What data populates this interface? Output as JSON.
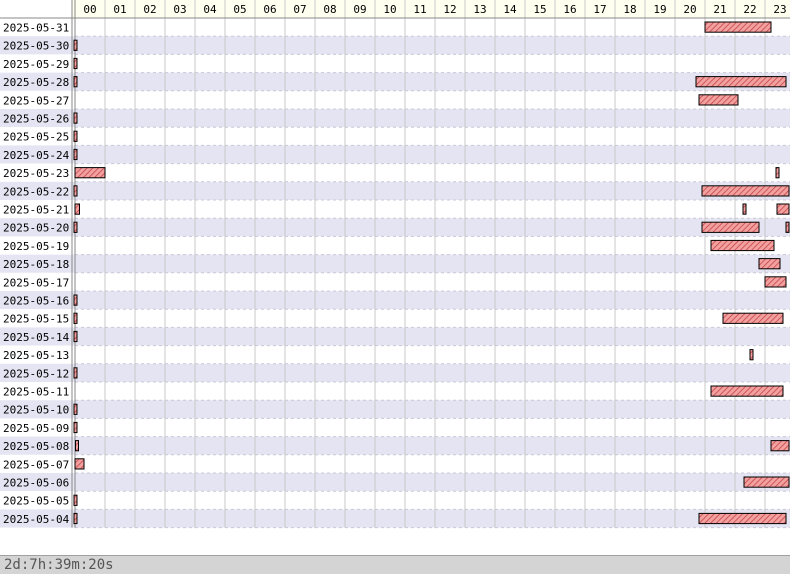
{
  "chart_data": {
    "type": "bar",
    "hours": [
      "00",
      "01",
      "02",
      "03",
      "04",
      "05",
      "06",
      "07",
      "08",
      "09",
      "10",
      "11",
      "12",
      "13",
      "14",
      "15",
      "16",
      "17",
      "18",
      "19",
      "20",
      "21",
      "22",
      "23"
    ],
    "rows": [
      {
        "date": "2025-05-31",
        "intervals": [
          [
            21.0,
            23.2
          ]
        ]
      },
      {
        "date": "2025-05-30",
        "intervals": [
          [
            0.0,
            0.04
          ]
        ]
      },
      {
        "date": "2025-05-29",
        "intervals": [
          [
            0.0,
            0.04
          ]
        ]
      },
      {
        "date": "2025-05-28",
        "intervals": [
          [
            0.0,
            0.04
          ],
          [
            20.7,
            23.7
          ]
        ]
      },
      {
        "date": "2025-05-27",
        "intervals": [
          [
            20.8,
            22.1
          ]
        ]
      },
      {
        "date": "2025-05-26",
        "intervals": [
          [
            0.0,
            0.04
          ]
        ]
      },
      {
        "date": "2025-05-25",
        "intervals": [
          [
            0.0,
            0.04
          ]
        ]
      },
      {
        "date": "2025-05-24",
        "intervals": [
          [
            0.0,
            0.04
          ]
        ]
      },
      {
        "date": "2025-05-23",
        "intervals": [
          [
            0.0,
            1.0
          ],
          [
            23.4,
            23.45
          ]
        ]
      },
      {
        "date": "2025-05-22",
        "intervals": [
          [
            0.0,
            0.04
          ],
          [
            20.9,
            23.8
          ]
        ]
      },
      {
        "date": "2025-05-21",
        "intervals": [
          [
            0.0,
            0.15
          ],
          [
            22.3,
            22.4
          ],
          [
            23.4,
            23.8
          ]
        ]
      },
      {
        "date": "2025-05-20",
        "intervals": [
          [
            0.0,
            0.04
          ],
          [
            20.9,
            22.8
          ],
          [
            23.7,
            23.8
          ]
        ]
      },
      {
        "date": "2025-05-19",
        "intervals": [
          [
            21.2,
            23.3
          ]
        ]
      },
      {
        "date": "2025-05-18",
        "intervals": [
          [
            22.8,
            23.5
          ]
        ]
      },
      {
        "date": "2025-05-17",
        "intervals": [
          [
            23.0,
            23.7
          ]
        ]
      },
      {
        "date": "2025-05-16",
        "intervals": [
          [
            0.0,
            0.04
          ]
        ]
      },
      {
        "date": "2025-05-15",
        "intervals": [
          [
            0.0,
            0.04
          ],
          [
            21.6,
            23.6
          ]
        ]
      },
      {
        "date": "2025-05-14",
        "intervals": [
          [
            0.0,
            0.04
          ]
        ]
      },
      {
        "date": "2025-05-13",
        "intervals": [
          [
            22.5,
            22.6
          ]
        ]
      },
      {
        "date": "2025-05-12",
        "intervals": [
          [
            0.0,
            0.04
          ]
        ]
      },
      {
        "date": "2025-05-11",
        "intervals": [
          [
            21.2,
            23.6
          ]
        ]
      },
      {
        "date": "2025-05-10",
        "intervals": [
          [
            0.0,
            0.04
          ]
        ]
      },
      {
        "date": "2025-05-09",
        "intervals": [
          [
            0.0,
            0.04
          ]
        ]
      },
      {
        "date": "2025-05-08",
        "intervals": [
          [
            0.05,
            0.15
          ],
          [
            23.2,
            23.8
          ]
        ]
      },
      {
        "date": "2025-05-07",
        "intervals": [
          [
            0.0,
            0.3
          ]
        ]
      },
      {
        "date": "2025-05-06",
        "intervals": [
          [
            22.3,
            23.8
          ]
        ]
      },
      {
        "date": "2025-05-05",
        "intervals": [
          [
            0.0,
            0.04
          ]
        ]
      },
      {
        "date": "2025-05-04",
        "intervals": [
          [
            0.0,
            0.04
          ],
          [
            20.8,
            23.7
          ]
        ]
      }
    ],
    "colors": {
      "bar_fill": "#f2a0a0",
      "bar_stripe": "#c04040",
      "bar_stroke": "#000000",
      "row_alt": "#e4e4f2",
      "header_bg": "#fffff0",
      "footer_bg": "#d4d4d4"
    },
    "legend": "none",
    "grid": true
  },
  "footer": {
    "total": "2d:7h:39m:20s"
  }
}
